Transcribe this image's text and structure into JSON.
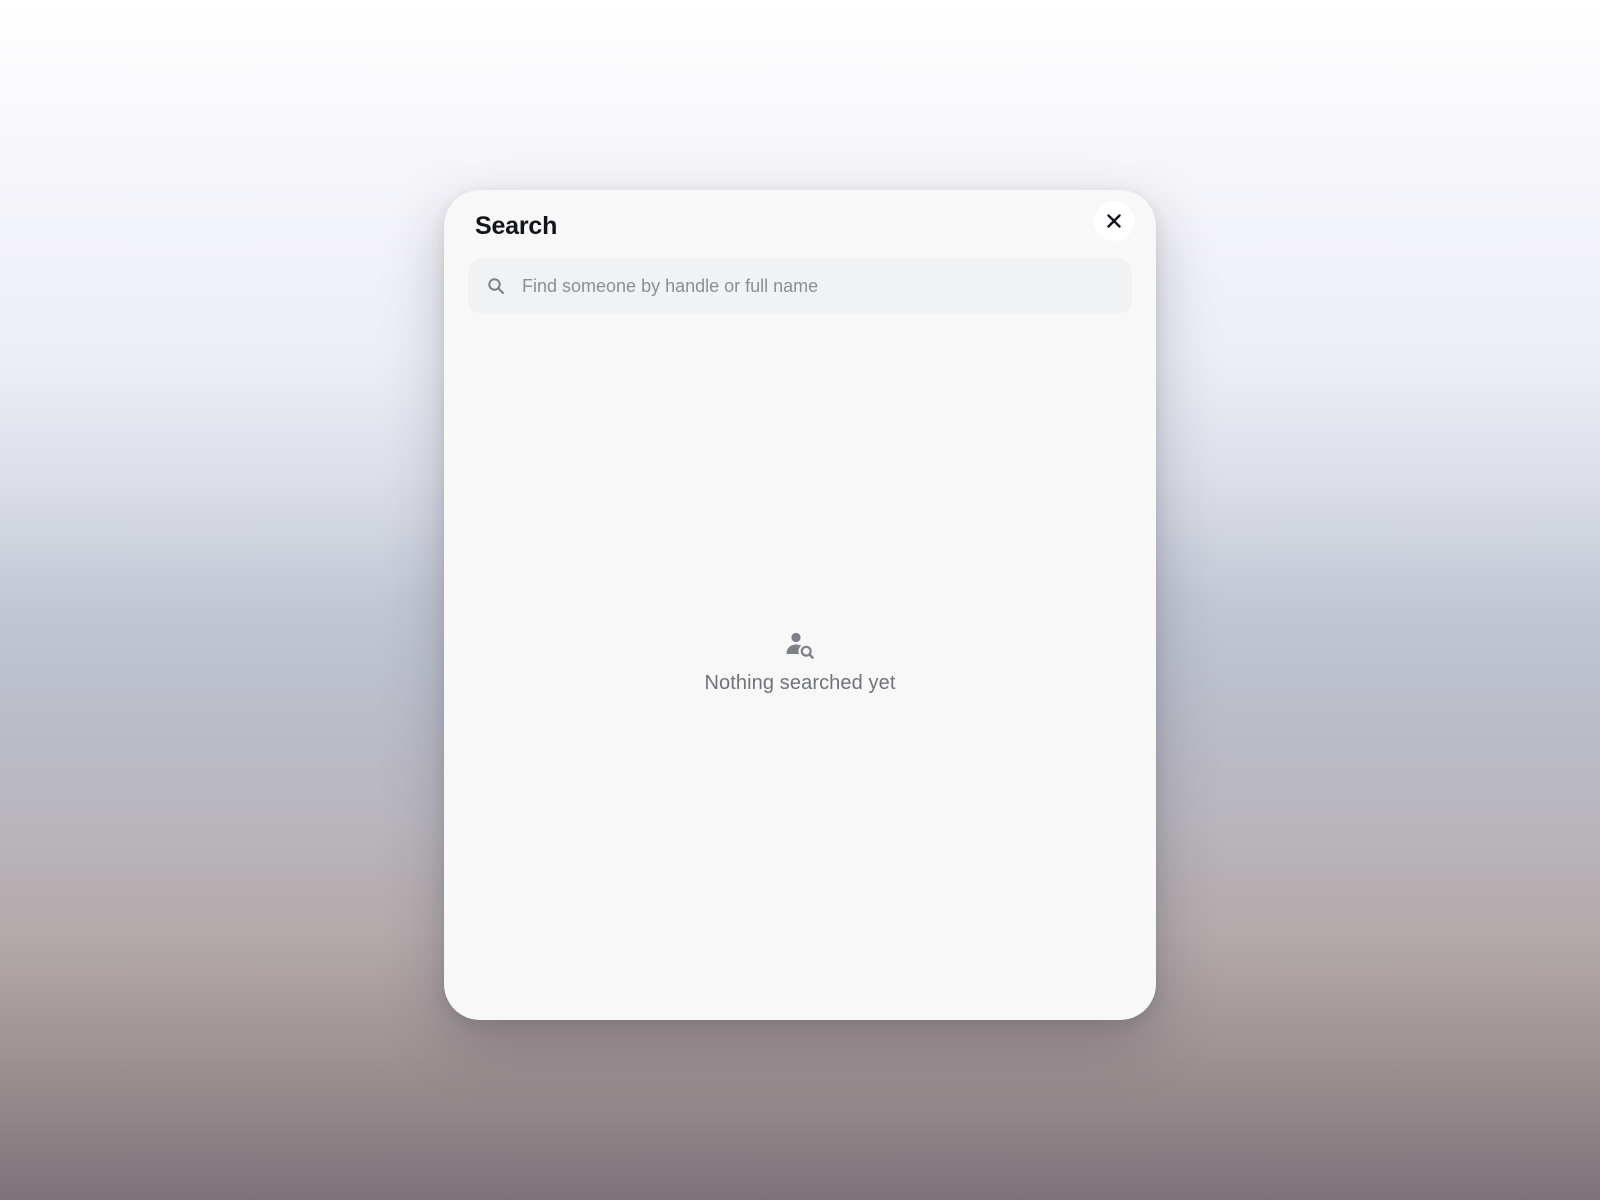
{
  "modal": {
    "title": "Search",
    "close_icon": "close-icon"
  },
  "search": {
    "icon": "search-icon",
    "placeholder": "Find someone by handle or full name",
    "value": ""
  },
  "empty_state": {
    "icon": "person-search-icon",
    "message": "Nothing searched yet"
  },
  "colors": {
    "modal_background": "#f8f8f8",
    "search_field_background": "#f1f2f3",
    "title_text": "#111418",
    "placeholder_text": "#8b8f95",
    "empty_icon": "#7d8086",
    "empty_text": "#6f7378"
  }
}
